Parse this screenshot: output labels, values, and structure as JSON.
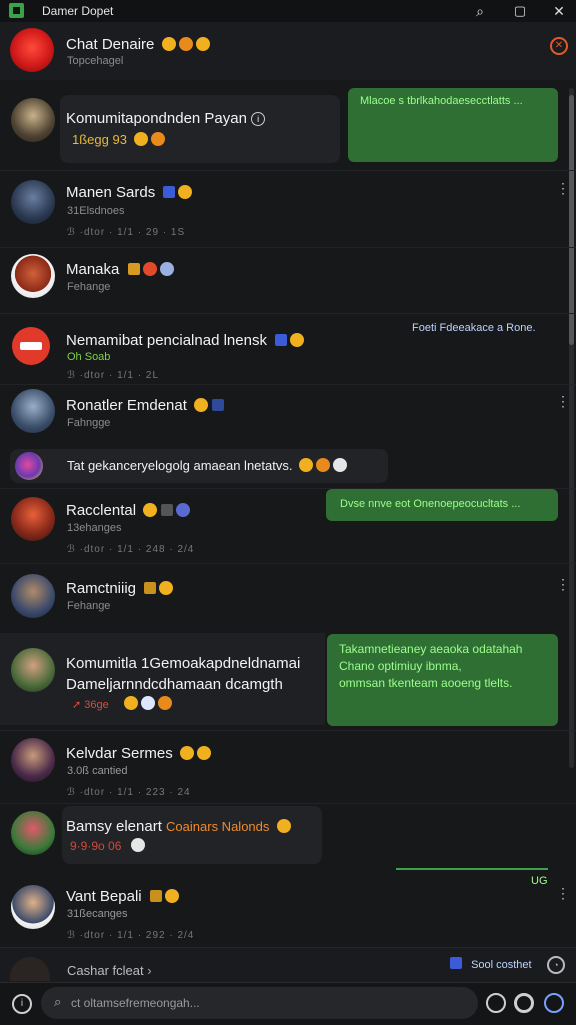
{
  "app": {
    "title": "Damer Dopet"
  },
  "titlebar_icons": [
    "search-icon",
    "window-icon",
    "close-icon"
  ],
  "header": {
    "name": "Chat Denaire",
    "subtitle": "Topcehagel"
  },
  "chats": [
    {
      "name": "Komumitapondnden Payan",
      "sub": "1ßegg  93",
      "reply": "Mlacoe s tbrlkahodaesecctlatts ..."
    },
    {
      "name": "Manen Sards",
      "sub": "31Elsdnoes",
      "meta": "ℬ ·dtor · 1/1 · 29 · 1S"
    },
    {
      "name": "Manaka",
      "sub": "Fehange"
    },
    {
      "name": "Nemamibat pencialnad lnensk",
      "sub": "Oh Soab",
      "meta": "ℬ ·dtor · 1/1 · 2L",
      "note": "Foeti  Fdeeakace a Rone."
    },
    {
      "name": "Ronatler Emdenat",
      "sub": "Fahngge"
    },
    {
      "name": "Tat gekanceryelogolg amaean lnetatvs."
    },
    {
      "name": "Racclental",
      "sub": "13ehanges",
      "meta": "ℬ ·dtor · 1/1 · 248 · 2/4",
      "reply": "Dvse nnve eot Onenoepeocucltats ..."
    },
    {
      "name": "Ramctniiig",
      "sub": "Fehange"
    },
    {
      "name": "Komumitla 1Gemoakapdneldnamai",
      "name2": "Dameljarnndcdhamaan dcamgth",
      "sub": "36ge",
      "reply_lines": [
        "Takamnetieaney aeaoka odatahah",
        "Chano optimiuy ibnma,",
        "ommsan tkenteam aooeng tlelts."
      ]
    },
    {
      "name": "Kelvdar Sermes",
      "sub": "3.0ß cantied",
      "meta": "ℬ ·dtor · 1/1 · 223 · 24"
    },
    {
      "name": "Bamsy elenart",
      "highlight": "Coainars Nalonds",
      "sub": "9·9·9o  06"
    },
    {
      "name": "Vant Bepali",
      "sub": "31ßecanges",
      "meta": "ℬ ·dtor · 1/1 · 292 · 2/4",
      "tag": "UG"
    }
  ],
  "footer_row": {
    "label": "Cashar fcleat",
    "badge": "Sool costhet"
  },
  "search": {
    "placeholder": "ct oltamsefremeongah..."
  },
  "colors": {
    "accent_green": "#2f6f34",
    "text_green": "#9cff8c",
    "badge_red": "#e23a2a"
  }
}
